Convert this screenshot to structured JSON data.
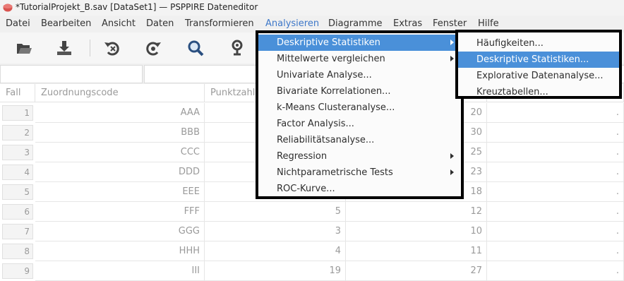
{
  "window": {
    "title": "*TutorialProjekt_B.sav [DataSet1] — PSPPIRE Dateneditor"
  },
  "menubar": [
    {
      "label": "Datei",
      "active": false
    },
    {
      "label": "Bearbeiten",
      "active": false
    },
    {
      "label": "Ansicht",
      "active": false
    },
    {
      "label": "Daten",
      "active": false
    },
    {
      "label": "Transformieren",
      "active": false
    },
    {
      "label": "Analysieren",
      "active": true
    },
    {
      "label": "Diagramme",
      "active": false
    },
    {
      "label": "Extras",
      "active": false
    },
    {
      "label": "Fenster",
      "active": false
    },
    {
      "label": "Hilfe",
      "active": false
    }
  ],
  "toolbar": {
    "icons": [
      "open-icon",
      "save-icon",
      "undo-icon",
      "redo-icon",
      "find-icon",
      "variable-icon"
    ]
  },
  "grid": {
    "headers": {
      "row": "Fall",
      "col1": "Zuordnungscode",
      "col2": "Punktzahl"
    },
    "rows": [
      {
        "n": "1",
        "code": "AAA",
        "p1": "",
        "p2": "20",
        "dot": "."
      },
      {
        "n": "2",
        "code": "BBB",
        "p1": "",
        "p2": "30",
        "dot": "."
      },
      {
        "n": "3",
        "code": "CCC",
        "p1": "",
        "p2": "25",
        "dot": "."
      },
      {
        "n": "4",
        "code": "DDD",
        "p1": "",
        "p2": "23",
        "dot": "."
      },
      {
        "n": "5",
        "code": "EEE",
        "p1": "",
        "p2": "18",
        "dot": "."
      },
      {
        "n": "6",
        "code": "FFF",
        "p1": "5",
        "p2": "12",
        "dot": "."
      },
      {
        "n": "7",
        "code": "GGG",
        "p1": "3",
        "p2": "10",
        "dot": "."
      },
      {
        "n": "8",
        "code": "HHH",
        "p1": "4",
        "p2": "11",
        "dot": "."
      },
      {
        "n": "9",
        "code": "III",
        "p1": "19",
        "p2": "27",
        "dot": "."
      }
    ]
  },
  "analysieren_menu": [
    {
      "label": "Deskriptive Statistiken",
      "submenu": true,
      "highlighted": true
    },
    {
      "label": "Mittelwerte vergleichen",
      "submenu": true,
      "highlighted": false
    },
    {
      "label": "Univariate Analyse...",
      "submenu": false,
      "highlighted": false
    },
    {
      "label": "Bivariate Korrelationen...",
      "submenu": false,
      "highlighted": false
    },
    {
      "label": "k-Means Clusteranalyse...",
      "submenu": false,
      "highlighted": false
    },
    {
      "label": "Factor Analysis...",
      "submenu": false,
      "highlighted": false
    },
    {
      "label": "Reliabilitätsanalyse...",
      "submenu": false,
      "highlighted": false
    },
    {
      "label": "Regression",
      "submenu": true,
      "highlighted": false
    },
    {
      "label": "Nichtparametrische Tests",
      "submenu": true,
      "highlighted": false
    },
    {
      "label": "ROC-Kurve...",
      "submenu": false,
      "highlighted": false
    }
  ],
  "deskriptiv_submenu": [
    {
      "label": "Häufigkeiten...",
      "highlighted": false
    },
    {
      "label": "Deskriptive Statistiken...",
      "highlighted": true
    },
    {
      "label": "Explorative Datenanalyse...",
      "highlighted": false
    },
    {
      "label": "Kreuztabellen...",
      "highlighted": false
    }
  ],
  "colors": {
    "highlight": "#4a90d9",
    "menu_border": "#000000",
    "active_menu_text": "#3e78c9"
  }
}
